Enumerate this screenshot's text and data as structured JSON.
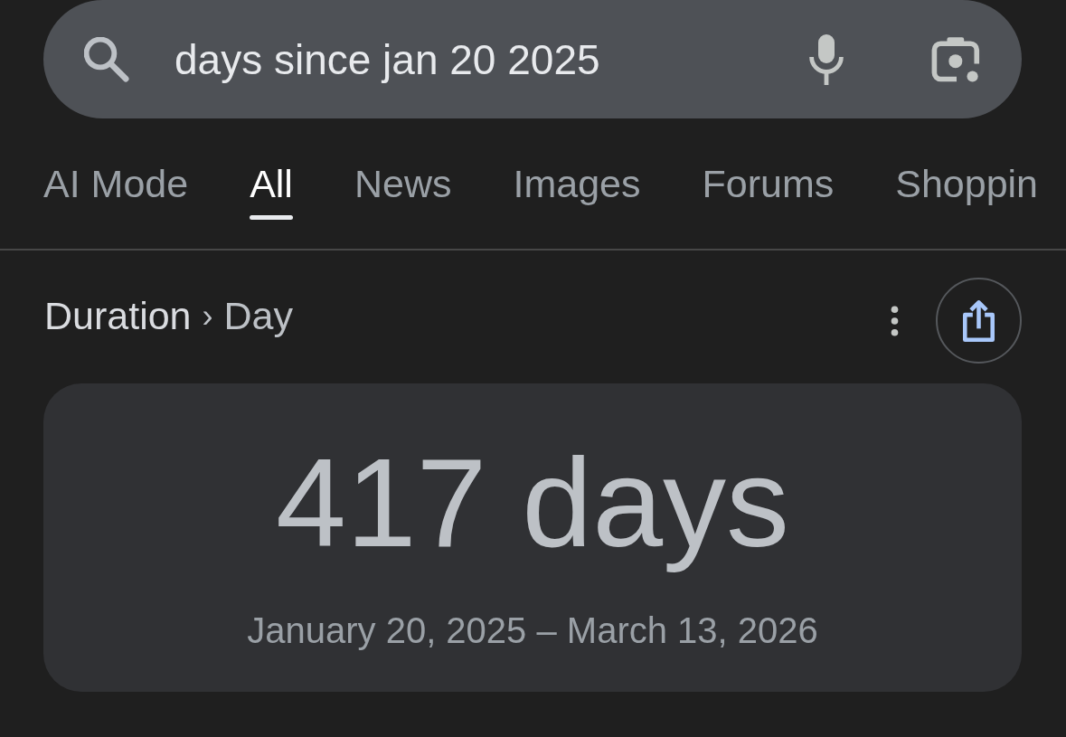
{
  "search": {
    "value": "days since jan 20 2025"
  },
  "tabs": [
    {
      "label": "AI Mode",
      "selected": false
    },
    {
      "label": "All",
      "selected": true
    },
    {
      "label": "News",
      "selected": false
    },
    {
      "label": "Images",
      "selected": false
    },
    {
      "label": "Forums",
      "selected": false
    },
    {
      "label": "Shoppin",
      "selected": false
    }
  ],
  "breadcrumb": {
    "items": [
      "Duration",
      "Day"
    ],
    "separator": "›"
  },
  "result": {
    "value": "417 days",
    "range": "January 20, 2025 – March 13, 2026"
  }
}
